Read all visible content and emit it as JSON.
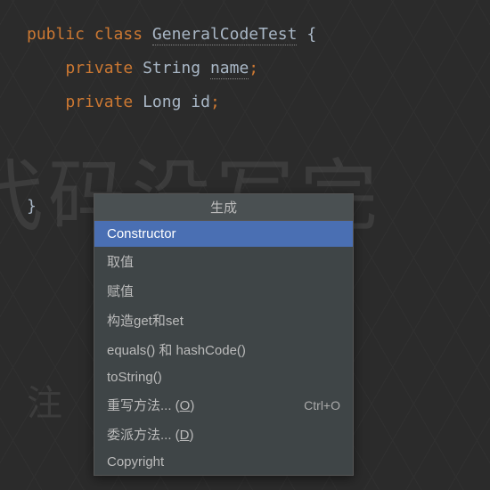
{
  "code": {
    "kw_public": "public",
    "kw_class": "class",
    "class_name": "GeneralCodeTest",
    "open_brace": "{",
    "kw_private1": "private",
    "type_string": "String",
    "field_name": "name",
    "semicolon1": ";",
    "kw_private2": "private",
    "type_long": "Long",
    "field_id": "id",
    "semicolon2": ";",
    "close_brace": "}"
  },
  "popup": {
    "title": "生成",
    "items": [
      {
        "label": "Constructor",
        "shortcut": "",
        "selected": true
      },
      {
        "label": "取值",
        "shortcut": "",
        "selected": false
      },
      {
        "label": "赋值",
        "shortcut": "",
        "selected": false
      },
      {
        "label": "构造get和set",
        "shortcut": "",
        "selected": false
      },
      {
        "label": "equals() 和 hashCode()",
        "shortcut": "",
        "selected": false
      },
      {
        "label": "toString()",
        "shortcut": "",
        "selected": false
      },
      {
        "label": "重写方法... ",
        "mnemonic": "O",
        "aft": ")",
        "shortcut": "Ctrl+O",
        "selected": false
      },
      {
        "label": "委派方法... ",
        "mnemonic": "D",
        "aft": ")",
        "shortcut": "",
        "selected": false
      },
      {
        "label": "Copyright",
        "shortcut": "",
        "selected": false
      }
    ]
  },
  "watermark": {
    "line1": "代码没写完",
    "line2": "注"
  }
}
